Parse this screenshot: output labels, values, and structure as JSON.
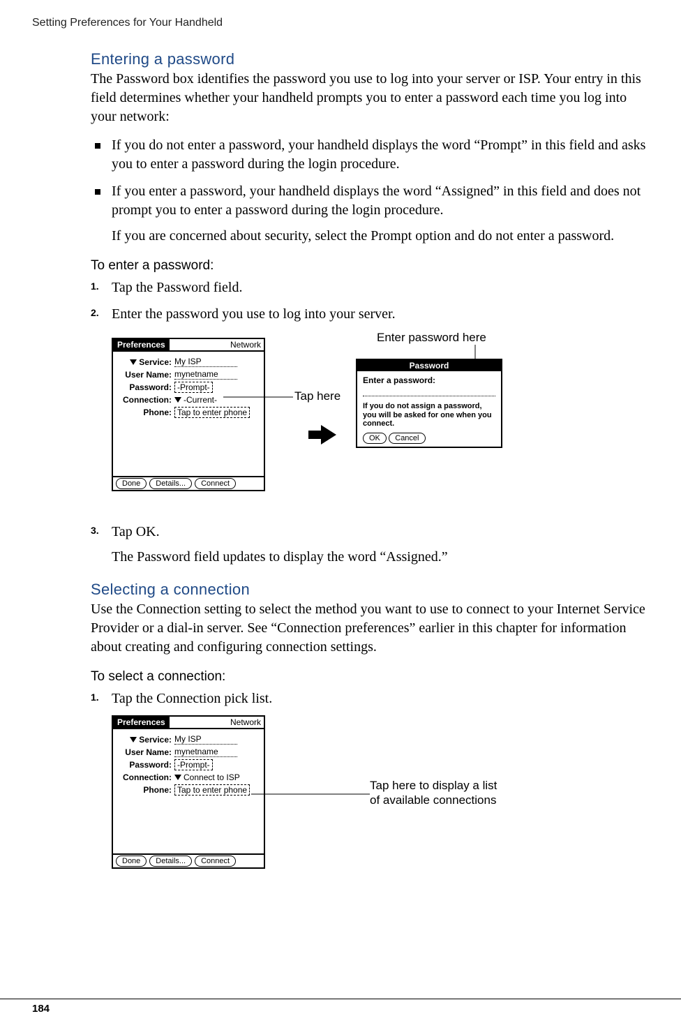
{
  "running_head": "Setting Preferences for Your Handheld",
  "page_number": "184",
  "section1": {
    "title": "Entering a password",
    "intro": "The Password box identifies the password you use to log into your server or ISP. Your entry in this field determines whether your handheld prompts you to enter a password each time you log into your network:",
    "bullet1": "If you do not enter a password, your handheld displays the word “Prompt” in this field and asks you to enter a password during the login procedure.",
    "bullet2": "If you enter a password, your handheld displays the word “Assigned” in this field and does not prompt you to enter a password during the login procedure.",
    "bullet2_sub": "If you are concerned about security, select the Prompt option and do not enter a password.",
    "proc_title": "To enter a password:",
    "step1": "Tap the Password field.",
    "step2": "Enter the password you use to log into your server.",
    "step3": "Tap OK.",
    "step3_sub": "The Password field updates to display the word “Assigned.”"
  },
  "figure1": {
    "tap_here": "Tap here",
    "enter_pw": "Enter password here",
    "prefs_title": "Preferences",
    "prefs_cat": "Network",
    "labels": {
      "service": "Service:",
      "user": "User Name:",
      "password": "Password:",
      "connection": "Connection:",
      "phone": "Phone:"
    },
    "values": {
      "service": "My ISP",
      "user": "mynetname",
      "password": "-Prompt-",
      "connection": "-Current-",
      "phone": "Tap to enter phone"
    },
    "buttons": {
      "done": "Done",
      "details": "Details...",
      "connect": "Connect"
    },
    "dialog": {
      "title": "Password",
      "prompt": "Enter a password:",
      "note": "If you do not assign a password, you will be asked for one when you connect.",
      "ok": "OK",
      "cancel": "Cancel"
    }
  },
  "section2": {
    "title": "Selecting a connection",
    "intro": "Use the Connection setting to select the method you want to use to connect to your Internet Service Provider or a dial-in server. See “Connection preferences” earlier in this chapter for information about creating and configuring connection settings.",
    "proc_title": "To select a connection:",
    "step1": "Tap the Connection pick list."
  },
  "figure2": {
    "callout": "Tap here to display a list of available connections",
    "connection_value": "Connect to ISP"
  }
}
